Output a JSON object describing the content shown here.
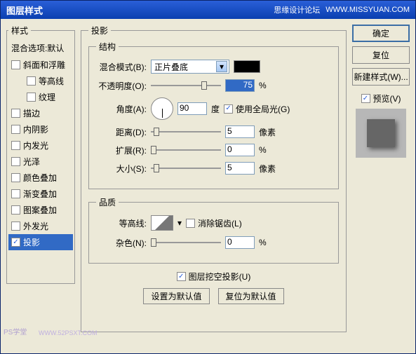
{
  "titlebar": {
    "title": "图层样式",
    "forum": "思缘设计论坛",
    "url": "WWW.MISSYUAN.COM"
  },
  "left": {
    "legend": "样式",
    "header": "混合选项:默认",
    "items": [
      {
        "label": "斜面和浮雕",
        "checked": false,
        "sub": false
      },
      {
        "label": "等高线",
        "checked": false,
        "sub": true
      },
      {
        "label": "纹理",
        "checked": false,
        "sub": true
      },
      {
        "label": "描边",
        "checked": false,
        "sub": false
      },
      {
        "label": "内阴影",
        "checked": false,
        "sub": false
      },
      {
        "label": "内发光",
        "checked": false,
        "sub": false
      },
      {
        "label": "光泽",
        "checked": false,
        "sub": false
      },
      {
        "label": "颜色叠加",
        "checked": false,
        "sub": false
      },
      {
        "label": "渐变叠加",
        "checked": false,
        "sub": false
      },
      {
        "label": "图案叠加",
        "checked": false,
        "sub": false
      },
      {
        "label": "外发光",
        "checked": false,
        "sub": false
      },
      {
        "label": "投影",
        "checked": true,
        "sub": false,
        "selected": true
      }
    ]
  },
  "mid": {
    "legend": "投影",
    "structure": {
      "legend": "结构",
      "blend_label": "混合模式(B):",
      "blend_value": "正片叠底",
      "opacity_label": "不透明度(O):",
      "opacity_value": "75",
      "opacity_unit": "%",
      "angle_label": "角度(A):",
      "angle_value": "90",
      "angle_unit": "度",
      "global_light": "使用全局光(G)",
      "distance_label": "距离(D):",
      "distance_value": "5",
      "distance_unit": "像素",
      "spread_label": "扩展(R):",
      "spread_value": "0",
      "spread_unit": "%",
      "size_label": "大小(S):",
      "size_value": "5",
      "size_unit": "像素"
    },
    "quality": {
      "legend": "品质",
      "contour_label": "等高线:",
      "antialias": "消除锯齿(L)",
      "noise_label": "杂色(N):",
      "noise_value": "0",
      "noise_unit": "%"
    },
    "knockout": "图层挖空投影(U)",
    "btn_default": "设置为默认值",
    "btn_reset": "复位为默认值"
  },
  "right": {
    "ok": "确定",
    "reset": "复位",
    "newstyle": "新建样式(W)...",
    "preview": "预览(V)"
  },
  "watermark": {
    "a": "PS学堂",
    "b": "WWW.52PSXT.COM"
  }
}
